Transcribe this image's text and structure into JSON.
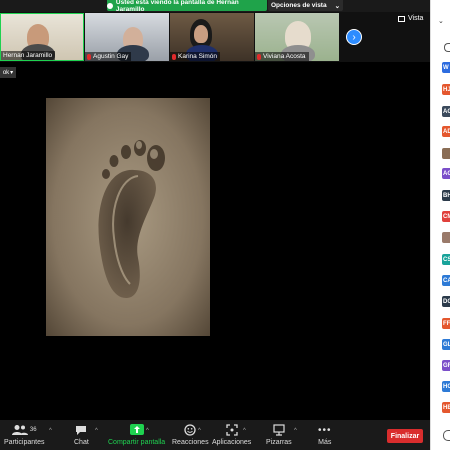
{
  "banner": {
    "text": "Usted está viendo la pantalla de Hernan Jaramillo",
    "view_options": "Opciones de vista"
  },
  "participants_strip": [
    {
      "name": "Hernan Jaramillo"
    },
    {
      "name": "Agustin Gay"
    },
    {
      "name": "Karina Simón"
    },
    {
      "name": "Viviana Acosta"
    }
  ],
  "vista_label": "Vista",
  "side_label": "ok",
  "sidebar_avatars": [
    {
      "initials": "W",
      "color": "#2d6cdf"
    },
    {
      "initials": "HJ",
      "color": "#e4572e"
    },
    {
      "initials": "AG",
      "color": "#3b4a5c"
    },
    {
      "initials": "AD",
      "color": "#e4572e"
    },
    {
      "initials": "",
      "color": "#8a6d55"
    },
    {
      "initials": "AG",
      "color": "#7b4fc9"
    },
    {
      "initials": "BH",
      "color": "#2b3a4a"
    },
    {
      "initials": "CM",
      "color": "#e0403c"
    },
    {
      "initials": "",
      "color": "#9a7a6a"
    },
    {
      "initials": "CS",
      "color": "#19a39a"
    },
    {
      "initials": "CA",
      "color": "#2d7ad6"
    },
    {
      "initials": "DG",
      "color": "#2b3a4a"
    },
    {
      "initials": "FF",
      "color": "#e4572e"
    },
    {
      "initials": "GL",
      "color": "#2d7ad6"
    },
    {
      "initials": "GR",
      "color": "#7b4fc9"
    },
    {
      "initials": "HO",
      "color": "#2d7ad6"
    },
    {
      "initials": "HE",
      "color": "#e4572e"
    }
  ],
  "toolbar": {
    "participants_label": "Participantes",
    "participants_count": "36",
    "chat_label": "Chat",
    "share_label": "Compartir pantalla",
    "reactions_label": "Reacciones",
    "apps_label": "Aplicaciones",
    "whiteboard_label": "Pizarras",
    "more_label": "Más",
    "end_label": "Finalizar"
  },
  "colors": {
    "share_green": "#1fd150",
    "end_red": "#d92d2d",
    "accent_blue": "#2d8cff"
  }
}
